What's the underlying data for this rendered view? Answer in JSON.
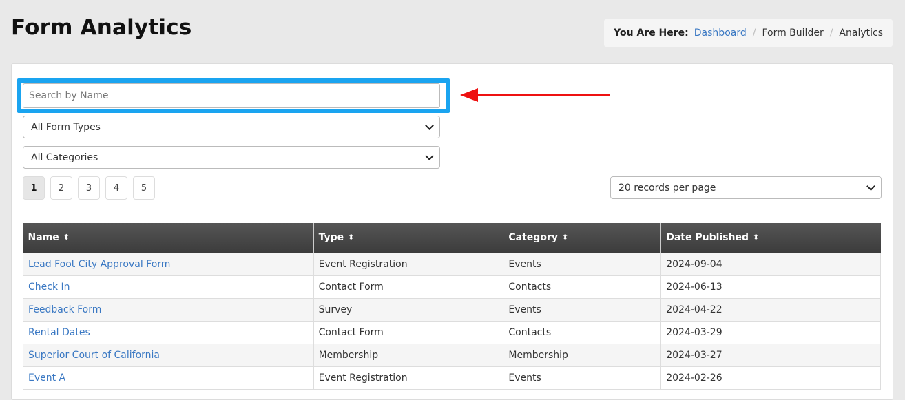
{
  "page_title": "Form Analytics",
  "breadcrumb": {
    "lead": "You Are Here:",
    "items": [
      "Dashboard",
      "Form Builder",
      "Analytics"
    ],
    "separator": "/"
  },
  "search": {
    "placeholder": "Search by Name",
    "value": ""
  },
  "filters": {
    "form_type": "All Form Types",
    "category": "All Categories"
  },
  "pagination": {
    "pages": [
      "1",
      "2",
      "3",
      "4",
      "5"
    ],
    "current": "1"
  },
  "per_page": "20 records per page",
  "table": {
    "headers": [
      "Name",
      "Type",
      "Category",
      "Date Published"
    ],
    "sort_icon": "⬍",
    "rows": [
      [
        "Lead Foot City Approval Form",
        "Event Registration",
        "Events",
        "2024-09-04"
      ],
      [
        "Check In",
        "Contact Form",
        "Contacts",
        "2024-06-13"
      ],
      [
        "Feedback Form",
        "Survey",
        "Events",
        "2024-04-22"
      ],
      [
        "Rental Dates",
        "Contact Form",
        "Contacts",
        "2024-03-29"
      ],
      [
        "Superior Court of California",
        "Membership",
        "Membership",
        "2024-03-27"
      ],
      [
        "Event A",
        "Event Registration",
        "Events",
        "2024-02-26"
      ]
    ]
  },
  "colors": {
    "highlight": "#1aa4f0",
    "annotation_arrow": "#ee1111",
    "link": "#3a78c3",
    "header_bg": "#444444"
  }
}
